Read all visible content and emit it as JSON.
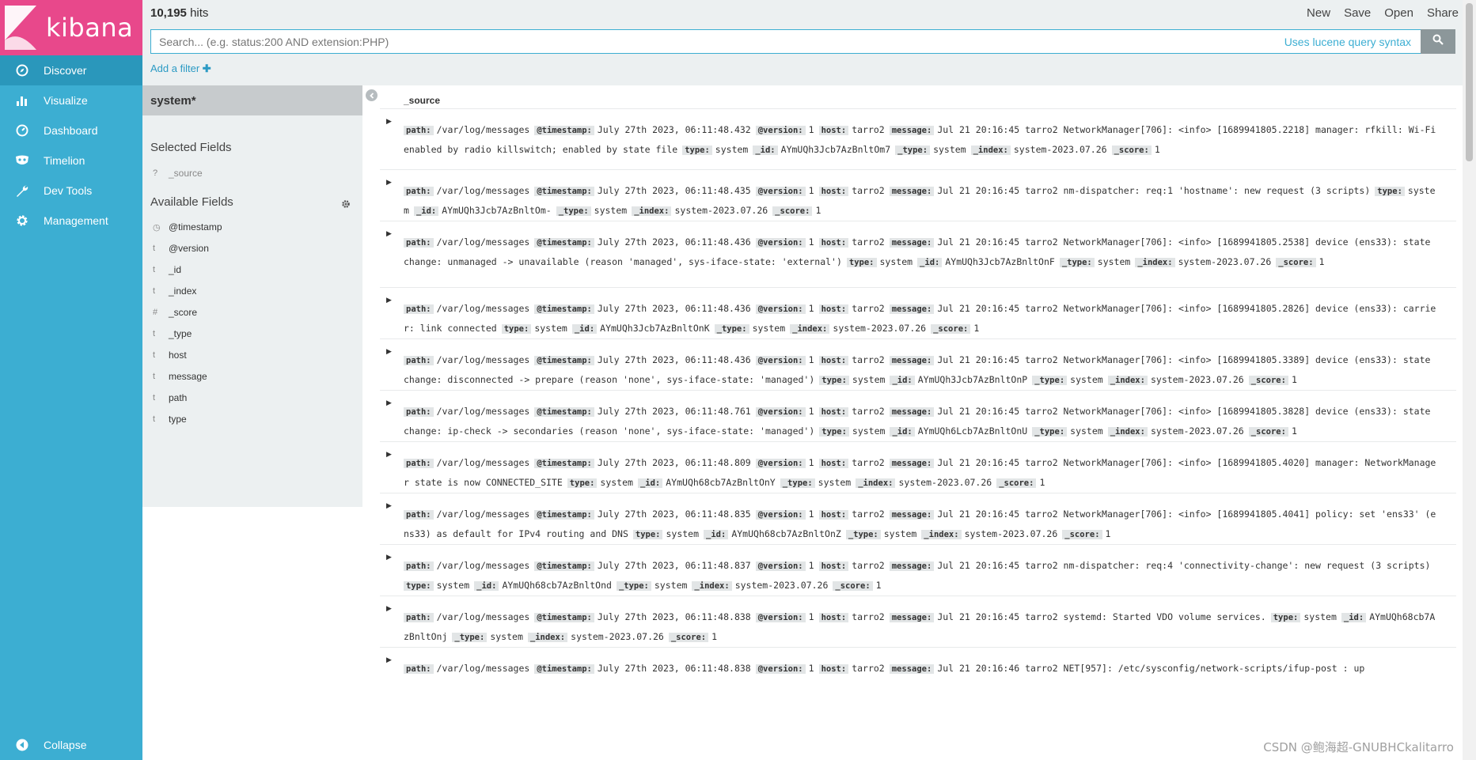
{
  "brand": {
    "name": "kibana",
    "colors": {
      "logo_bg": "#e8488b",
      "sidebar": "#3caed2",
      "active": "#2a97bb"
    }
  },
  "sidebar": {
    "items": [
      {
        "label": "Discover",
        "icon": "compass-icon",
        "active": true
      },
      {
        "label": "Visualize",
        "icon": "bar-chart-icon",
        "active": false
      },
      {
        "label": "Dashboard",
        "icon": "dashboard-icon",
        "active": false
      },
      {
        "label": "Timelion",
        "icon": "timelion-mask-icon",
        "active": false
      },
      {
        "label": "Dev Tools",
        "icon": "wrench-icon",
        "active": false
      },
      {
        "label": "Management",
        "icon": "gear-icon",
        "active": false
      }
    ],
    "collapse_label": "Collapse"
  },
  "topbar": {
    "hits_count": "10,195",
    "hits_label": "hits",
    "actions": [
      "New",
      "Save",
      "Open",
      "Share"
    ],
    "search_placeholder": "Search... (e.g. status:200 AND extension:PHP)",
    "lucene_link": "Uses lucene query syntax",
    "add_filter": "Add a filter"
  },
  "fields_panel": {
    "index_pattern": "system*",
    "selected_title": "Selected Fields",
    "selected_fields": [
      {
        "type": "?",
        "name": "_source"
      }
    ],
    "available_title": "Available Fields",
    "available_fields": [
      {
        "type": "◷",
        "name": "@timestamp"
      },
      {
        "type": "t",
        "name": "@version"
      },
      {
        "type": "t",
        "name": "_id"
      },
      {
        "type": "t",
        "name": "_index"
      },
      {
        "type": "#",
        "name": "_score"
      },
      {
        "type": "t",
        "name": "_type"
      },
      {
        "type": "t",
        "name": "host"
      },
      {
        "type": "t",
        "name": "message"
      },
      {
        "type": "t",
        "name": "path"
      },
      {
        "type": "t",
        "name": "type"
      }
    ]
  },
  "documents": {
    "column_header": "_source",
    "rows": [
      {
        "fields": [
          [
            "path:",
            "/var/log/messages"
          ],
          [
            "@timestamp:",
            "July 27th 2023, 06:11:48.432"
          ],
          [
            "@version:",
            "1"
          ],
          [
            "host:",
            "tarro2"
          ],
          [
            "message:",
            "Jul 21 20:16:45 tarro2 NetworkManager[706]: <info> [1689941805.2218] manager: rfkill: Wi-Fi enabled by radio killswitch; enabled by state file"
          ],
          [
            "type:",
            "system"
          ],
          [
            "_id:",
            "AYmUQh3Jcb7AzBnltOm7"
          ],
          [
            "_type:",
            "system"
          ],
          [
            "_index:",
            "system-2023.07.26"
          ],
          [
            "_score:",
            "1"
          ]
        ]
      },
      {
        "fields": [
          [
            "path:",
            "/var/log/messages"
          ],
          [
            "@timestamp:",
            "July 27th 2023, 06:11:48.435"
          ],
          [
            "@version:",
            "1"
          ],
          [
            "host:",
            "tarro2"
          ],
          [
            "message:",
            "Jul 21 20:16:45 tarro2 nm-dispatcher: req:1 'hostname': new request (3 scripts)"
          ],
          [
            "type:",
            "system"
          ],
          [
            "_id:",
            "AYmUQh3Jcb7AzBnltOm-"
          ],
          [
            "_type:",
            "system"
          ],
          [
            "_index:",
            "system-2023.07.26"
          ],
          [
            "_score:",
            "1"
          ]
        ]
      },
      {
        "fields": [
          [
            "path:",
            "/var/log/messages"
          ],
          [
            "@timestamp:",
            "July 27th 2023, 06:11:48.436"
          ],
          [
            "@version:",
            "1"
          ],
          [
            "host:",
            "tarro2"
          ],
          [
            "message:",
            "Jul 21 20:16:45 tarro2 NetworkManager[706]: <info> [1689941805.2538] device (ens33): state change: unmanaged -> unavailable (reason 'managed', sys-iface-state: 'external')"
          ],
          [
            "type:",
            "system"
          ],
          [
            "_id:",
            "AYmUQh3Jcb7AzBnltOnF"
          ],
          [
            "_type:",
            "system"
          ],
          [
            "_index:",
            "system-2023.07.26"
          ],
          [
            "_score:",
            "1"
          ]
        ]
      },
      {
        "fields": [
          [
            "path:",
            "/var/log/messages"
          ],
          [
            "@timestamp:",
            "July 27th 2023, 06:11:48.436"
          ],
          [
            "@version:",
            "1"
          ],
          [
            "host:",
            "tarro2"
          ],
          [
            "message:",
            "Jul 21 20:16:45 tarro2 NetworkManager[706]: <info> [1689941805.2826] device (ens33): carrier: link connected"
          ],
          [
            "type:",
            "system"
          ],
          [
            "_id:",
            "AYmUQh3Jcb7AzBnltOnK"
          ],
          [
            "_type:",
            "system"
          ],
          [
            "_index:",
            "system-2023.07.26"
          ],
          [
            "_score:",
            "1"
          ]
        ]
      },
      {
        "fields": [
          [
            "path:",
            "/var/log/messages"
          ],
          [
            "@timestamp:",
            "July 27th 2023, 06:11:48.436"
          ],
          [
            "@version:",
            "1"
          ],
          [
            "host:",
            "tarro2"
          ],
          [
            "message:",
            "Jul 21 20:16:45 tarro2 NetworkManager[706]: <info> [1689941805.3389] device (ens33): state change: disconnected -> prepare (reason 'none', sys-iface-state: 'managed')"
          ],
          [
            "type:",
            "system"
          ],
          [
            "_id:",
            "AYmUQh3Jcb7AzBnltOnP"
          ],
          [
            "_type:",
            "system"
          ],
          [
            "_index:",
            "system-2023.07.26"
          ],
          [
            "_score:",
            "1"
          ]
        ]
      },
      {
        "fields": [
          [
            "path:",
            "/var/log/messages"
          ],
          [
            "@timestamp:",
            "July 27th 2023, 06:11:48.761"
          ],
          [
            "@version:",
            "1"
          ],
          [
            "host:",
            "tarro2"
          ],
          [
            "message:",
            "Jul 21 20:16:45 tarro2 NetworkManager[706]: <info> [1689941805.3828] device (ens33): state change: ip-check -> secondaries (reason 'none', sys-iface-state: 'managed')"
          ],
          [
            "type:",
            "system"
          ],
          [
            "_id:",
            "AYmUQh6Lcb7AzBnltOnU"
          ],
          [
            "_type:",
            "system"
          ],
          [
            "_index:",
            "system-2023.07.26"
          ],
          [
            "_score:",
            "1"
          ]
        ]
      },
      {
        "fields": [
          [
            "path:",
            "/var/log/messages"
          ],
          [
            "@timestamp:",
            "July 27th 2023, 06:11:48.809"
          ],
          [
            "@version:",
            "1"
          ],
          [
            "host:",
            "tarro2"
          ],
          [
            "message:",
            "Jul 21 20:16:45 tarro2 NetworkManager[706]: <info> [1689941805.4020] manager: NetworkManager state is now CONNECTED_SITE"
          ],
          [
            "type:",
            "system"
          ],
          [
            "_id:",
            "AYmUQh68cb7AzBnltOnY"
          ],
          [
            "_type:",
            "system"
          ],
          [
            "_index:",
            "system-2023.07.26"
          ],
          [
            "_score:",
            "1"
          ]
        ]
      },
      {
        "fields": [
          [
            "path:",
            "/var/log/messages"
          ],
          [
            "@timestamp:",
            "July 27th 2023, 06:11:48.835"
          ],
          [
            "@version:",
            "1"
          ],
          [
            "host:",
            "tarro2"
          ],
          [
            "message:",
            "Jul 21 20:16:45 tarro2 NetworkManager[706]: <info> [1689941805.4041] policy: set 'ens33' (ens33) as default for IPv4 routing and DNS"
          ],
          [
            "type:",
            "system"
          ],
          [
            "_id:",
            "AYmUQh68cb7AzBnltOnZ"
          ],
          [
            "_type:",
            "system"
          ],
          [
            "_index:",
            "system-2023.07.26"
          ],
          [
            "_score:",
            "1"
          ]
        ]
      },
      {
        "fields": [
          [
            "path:",
            "/var/log/messages"
          ],
          [
            "@timestamp:",
            "July 27th 2023, 06:11:48.837"
          ],
          [
            "@version:",
            "1"
          ],
          [
            "host:",
            "tarro2"
          ],
          [
            "message:",
            "Jul 21 20:16:45 tarro2 nm-dispatcher: req:4 'connectivity-change': new request (3 scripts)"
          ],
          [
            "type:",
            "system"
          ],
          [
            "_id:",
            "AYmUQh68cb7AzBnltOnd"
          ],
          [
            "_type:",
            "system"
          ],
          [
            "_index:",
            "system-2023.07.26"
          ],
          [
            "_score:",
            "1"
          ]
        ]
      },
      {
        "fields": [
          [
            "path:",
            "/var/log/messages"
          ],
          [
            "@timestamp:",
            "July 27th 2023, 06:11:48.838"
          ],
          [
            "@version:",
            "1"
          ],
          [
            "host:",
            "tarro2"
          ],
          [
            "message:",
            "Jul 21 20:16:45 tarro2 systemd: Started VDO volume services."
          ],
          [
            "type:",
            "system"
          ],
          [
            "_id:",
            "AYmUQh68cb7AzBnltOnj"
          ],
          [
            "_type:",
            "system"
          ],
          [
            "_index:",
            "system-2023.07.26"
          ],
          [
            "_score:",
            "1"
          ]
        ]
      },
      {
        "fields": [
          [
            "path:",
            "/var/log/messages"
          ],
          [
            "@timestamp:",
            "July 27th 2023, 06:11:48.838"
          ],
          [
            "@version:",
            "1"
          ],
          [
            "host:",
            "tarro2"
          ],
          [
            "message:",
            "Jul 21 20:16:46 tarro2 NET[957]: /etc/sysconfig/network-scripts/ifup-post : up"
          ]
        ]
      }
    ]
  },
  "watermark": "CSDN @鲍海超-GNUBHCkalitarro"
}
